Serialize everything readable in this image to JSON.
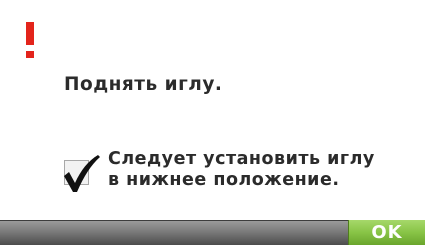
{
  "dialog": {
    "icon": "exclamation-warning-icon",
    "accent_color": "#e3241b",
    "message": "Поднять иглу.",
    "note_line1": "Следует установить иглу",
    "note_line2": "в нижнее положение.",
    "check_icon": "checkmark-icon",
    "ok_label": "OK",
    "ok_color": "#88c446"
  }
}
